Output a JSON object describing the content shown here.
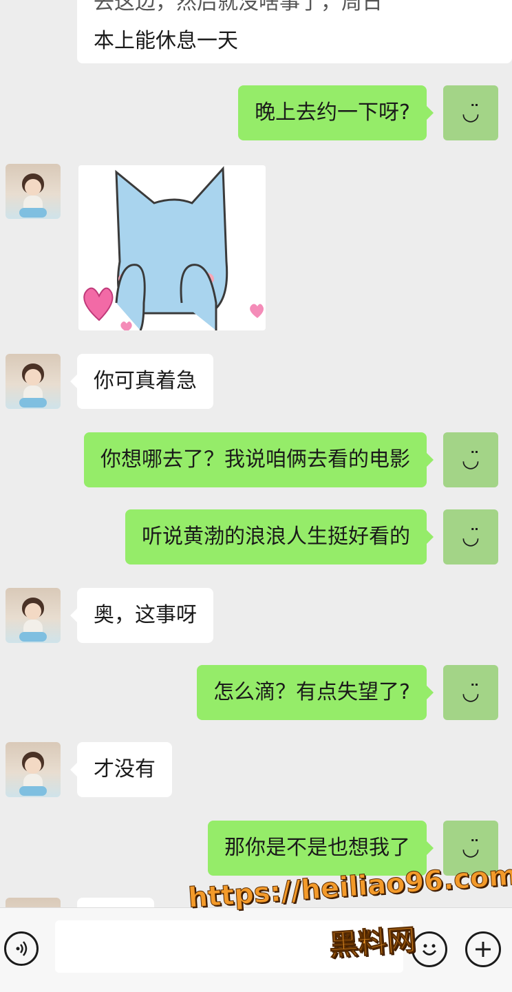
{
  "previous_message": {
    "partial_line": "去这边，然后就没啥事了，周日",
    "line": "本上能休息一天"
  },
  "messages": [
    {
      "from": "me",
      "text": "晚上去约一下呀?"
    },
    {
      "from": "her",
      "type": "sticker",
      "sticker": "blue-cat-covering-face-with-hearts"
    },
    {
      "from": "her",
      "text": "你可真着急"
    },
    {
      "from": "me",
      "text": "你想哪去了？我说咱俩去看的电影"
    },
    {
      "from": "me",
      "text": "听说黄渤的浪浪人生挺好看的"
    },
    {
      "from": "her",
      "text": "奥，这事呀"
    },
    {
      "from": "me",
      "text": "怎么滴？有点失望了?"
    },
    {
      "from": "her",
      "text": "才没有"
    },
    {
      "from": "me",
      "text": "那你是不是也想我了"
    }
  ],
  "icons": {
    "self_avatar": "smile-glyph",
    "voice": "voice-icon",
    "emoji": "emoji-icon",
    "more": "plus-icon"
  },
  "colors": {
    "outgoing_bubble": "#95ec69",
    "incoming_bubble": "#ffffff",
    "background": "#ededed",
    "watermark": "#f39a2a"
  },
  "watermark": {
    "url": "https://heiliao96.com",
    "name": "黑料网"
  }
}
